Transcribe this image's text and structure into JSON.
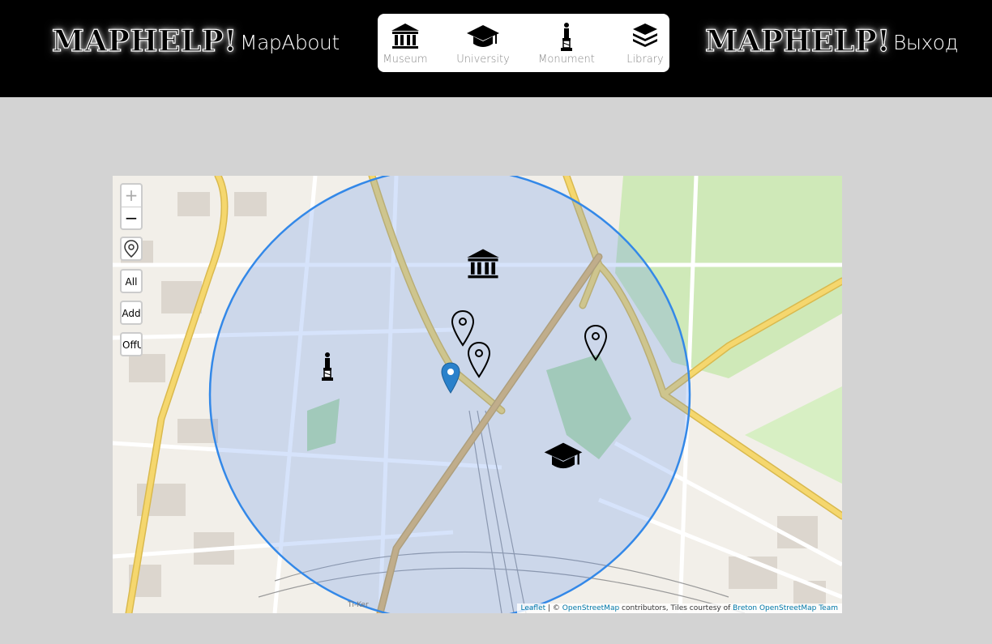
{
  "header": {
    "logo_left": "MAPHELP!",
    "about_link": "MapAbout",
    "logo_right": "MAPHELP!",
    "logout_link": "Выход"
  },
  "categories": [
    {
      "label": "Museum",
      "icon": "museum-icon"
    },
    {
      "label": "University",
      "icon": "graduation-cap-icon"
    },
    {
      "label": "Monument",
      "icon": "monument-icon"
    },
    {
      "label": "Library",
      "icon": "books-icon"
    }
  ],
  "map": {
    "zoom_in": "+",
    "zoom_out": "−",
    "locate_icon": "map-pin-icon",
    "buttons": {
      "all": "All",
      "add": "Add",
      "offusers": "OffUs"
    },
    "place_label": "Ti-Ker",
    "attribution": {
      "leaflet": "Leaflet",
      "sep": " | © ",
      "osm": "OpenStreetMap",
      "mid": " contributors, Tiles courtesy of ",
      "breton": "Breton OpenStreetMap Team"
    },
    "colors": {
      "radius_stroke": "#3388e8",
      "radius_fill": "#5b8ff0",
      "user_marker": "#2a81cb",
      "park": "#cfe9b8",
      "road_major": "#f5d76e"
    }
  }
}
